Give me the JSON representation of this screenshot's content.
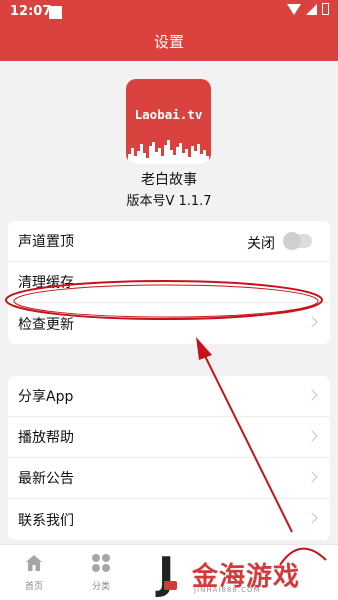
{
  "status_bar": {
    "time": "12:07"
  },
  "app_bar": {
    "title": "设置"
  },
  "app_info": {
    "logo_text": "Laobai.tv",
    "name": "老白故事",
    "version": "版本号V 1.1.7"
  },
  "settings_group_1": [
    {
      "label": "声道置顶",
      "toggle_label": "关闭",
      "toggle_on": false
    },
    {
      "label": "清理缓存"
    },
    {
      "label": "检查更新"
    }
  ],
  "settings_group_2": [
    {
      "label": "分享App"
    },
    {
      "label": "播放帮助"
    },
    {
      "label": "最新公告"
    },
    {
      "label": "联系我们"
    }
  ],
  "tab_bar": [
    {
      "label": "首页",
      "icon": "home-icon"
    },
    {
      "label": "分类",
      "icon": "grid-icon"
    }
  ],
  "watermark": {
    "text": "金海游戏",
    "sub": "JINHAI888.COM"
  },
  "colors": {
    "brand": "#d9423f",
    "annotation": "#c8121a"
  }
}
